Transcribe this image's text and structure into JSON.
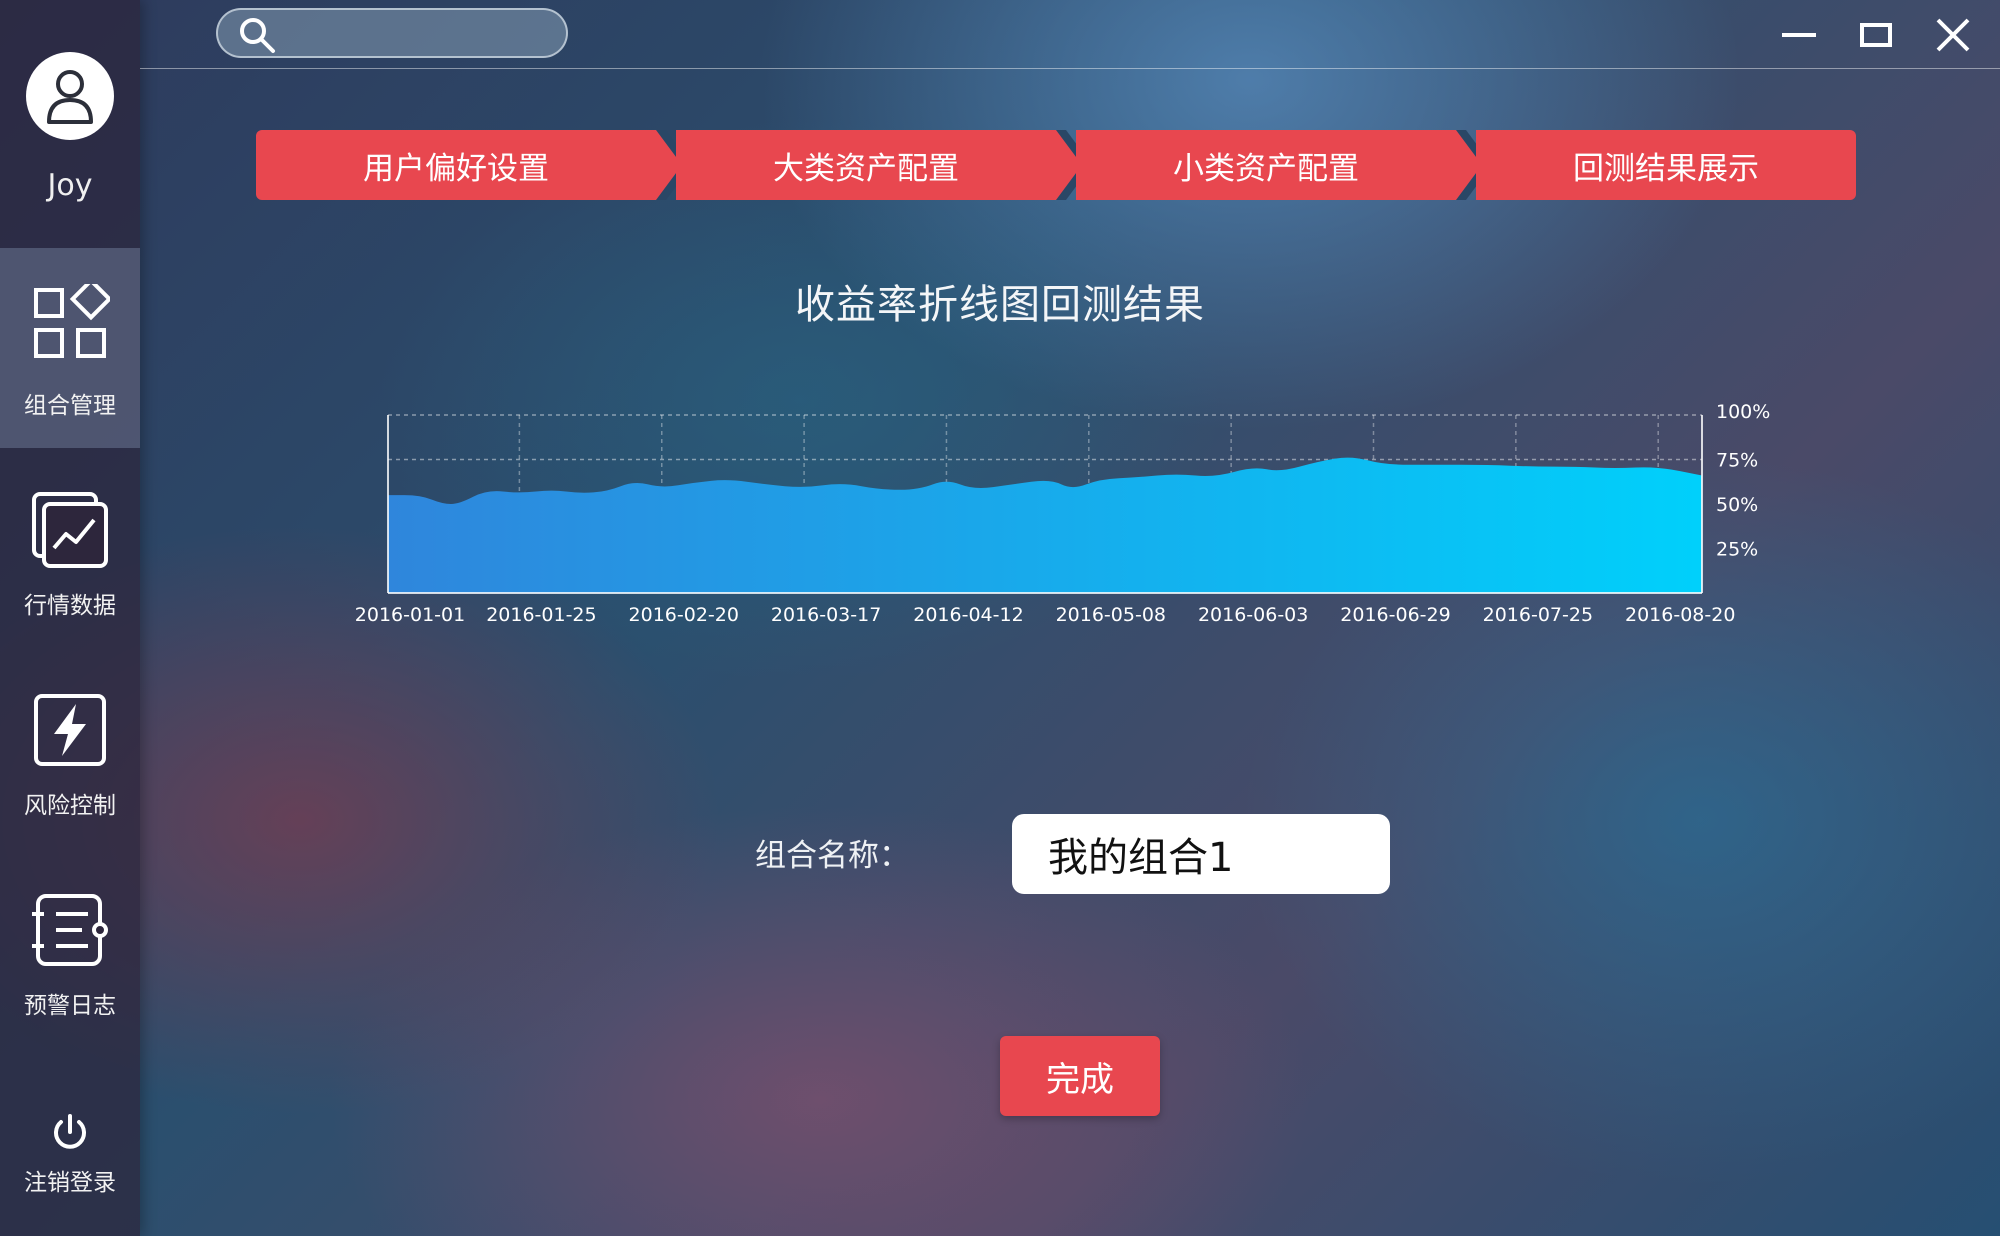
{
  "user": {
    "name": "Joy"
  },
  "sidebar": {
    "items": [
      {
        "label": "组合管理",
        "icon": "grid-icon",
        "active": true
      },
      {
        "label": "行情数据",
        "icon": "chart-window-icon",
        "active": false
      },
      {
        "label": "风险控制",
        "icon": "lightning-icon",
        "active": false
      },
      {
        "label": "预警日志",
        "icon": "log-list-icon",
        "active": false
      }
    ],
    "logout": {
      "label": "注销登录",
      "icon": "power-icon"
    }
  },
  "search": {
    "placeholder": "",
    "icon": "search-icon"
  },
  "window_controls": {
    "minimize": "minimize-icon",
    "maximize": "maximize-icon",
    "close": "close-icon"
  },
  "steps": [
    {
      "label": "用户偏好设置"
    },
    {
      "label": "大类资产配置"
    },
    {
      "label": "小类资产配置"
    },
    {
      "label": "回测结果展示"
    }
  ],
  "chart_title": "收益率折线图回测结果",
  "chart_data": {
    "type": "area",
    "x_tick_labels": [
      "2016-01-01",
      "2016-01-25",
      "2016-02-20",
      "2016-03-17",
      "2016-04-12",
      "2016-05-08",
      "2016-06-03",
      "2016-06-29",
      "2016-07-25",
      "2016-08-20"
    ],
    "y_tick_labels": [
      "100%",
      "75%",
      "50%",
      "25%"
    ],
    "ylim": [
      0,
      100
    ],
    "grid": true,
    "x_span": [
      "2016-01-01",
      "2016-08-28"
    ],
    "points": [
      [
        "2016-01-01",
        55
      ],
      [
        "2016-01-07",
        55
      ],
      [
        "2016-01-11",
        50
      ],
      [
        "2016-01-14",
        50
      ],
      [
        "2016-01-19",
        58
      ],
      [
        "2016-01-25",
        56
      ],
      [
        "2016-01-31",
        58
      ],
      [
        "2016-02-05",
        56
      ],
      [
        "2016-02-10",
        57
      ],
      [
        "2016-02-15",
        63
      ],
      [
        "2016-02-20",
        59
      ],
      [
        "2016-02-26",
        62
      ],
      [
        "2016-03-03",
        64
      ],
      [
        "2016-03-10",
        61
      ],
      [
        "2016-03-17",
        59
      ],
      [
        "2016-03-24",
        62
      ],
      [
        "2016-03-31",
        58
      ],
      [
        "2016-04-07",
        58
      ],
      [
        "2016-04-12",
        64
      ],
      [
        "2016-04-17",
        58
      ],
      [
        "2016-04-24",
        61
      ],
      [
        "2016-05-01",
        64
      ],
      [
        "2016-05-05",
        58
      ],
      [
        "2016-05-10",
        64
      ],
      [
        "2016-05-17",
        65
      ],
      [
        "2016-05-24",
        67
      ],
      [
        "2016-05-31",
        65
      ],
      [
        "2016-06-07",
        71
      ],
      [
        "2016-06-12",
        68
      ],
      [
        "2016-06-19",
        74
      ],
      [
        "2016-06-25",
        77
      ],
      [
        "2016-07-01",
        72
      ],
      [
        "2016-07-10",
        72
      ],
      [
        "2016-07-20",
        72
      ],
      [
        "2016-07-28",
        71
      ],
      [
        "2016-08-05",
        71
      ],
      [
        "2016-08-12",
        70
      ],
      [
        "2016-08-20",
        71
      ],
      [
        "2016-08-28",
        66
      ]
    ],
    "colors": {
      "start": "#2f86dc",
      "end": "#00d0fb"
    }
  },
  "form": {
    "name_label": "组合名称：",
    "name_value": "我的组合1"
  },
  "done_button": {
    "label": "完成"
  },
  "colors": {
    "accent": "#e8474f"
  }
}
